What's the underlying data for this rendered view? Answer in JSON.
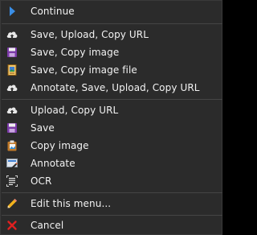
{
  "menu": {
    "items": [
      {
        "label": "Continue",
        "icon": "play-arrow-icon"
      },
      {
        "label": "Save, Upload, Copy URL",
        "icon": "cloud-upload-icon"
      },
      {
        "label": "Save, Copy image",
        "icon": "floppy-disk-icon"
      },
      {
        "label": "Save, Copy image file",
        "icon": "file-image-icon"
      },
      {
        "label": "Annotate, Save, Upload, Copy URL",
        "icon": "cloud-upload-icon"
      },
      {
        "label": "Upload, Copy URL",
        "icon": "cloud-upload-icon"
      },
      {
        "label": "Save",
        "icon": "floppy-disk-icon"
      },
      {
        "label": "Copy image",
        "icon": "clipboard-image-icon"
      },
      {
        "label": "Annotate",
        "icon": "annotate-icon"
      },
      {
        "label": "OCR",
        "icon": "ocr-text-icon"
      },
      {
        "label": "Edit this menu...",
        "icon": "pencil-icon"
      },
      {
        "label": "Cancel",
        "icon": "red-x-icon"
      }
    ]
  },
  "colors": {
    "background": "#2b2b2b",
    "text": "#f2f2f2",
    "separator": "#454545",
    "continue_accent": "#3a8ee6",
    "cancel_accent": "#e02020"
  }
}
